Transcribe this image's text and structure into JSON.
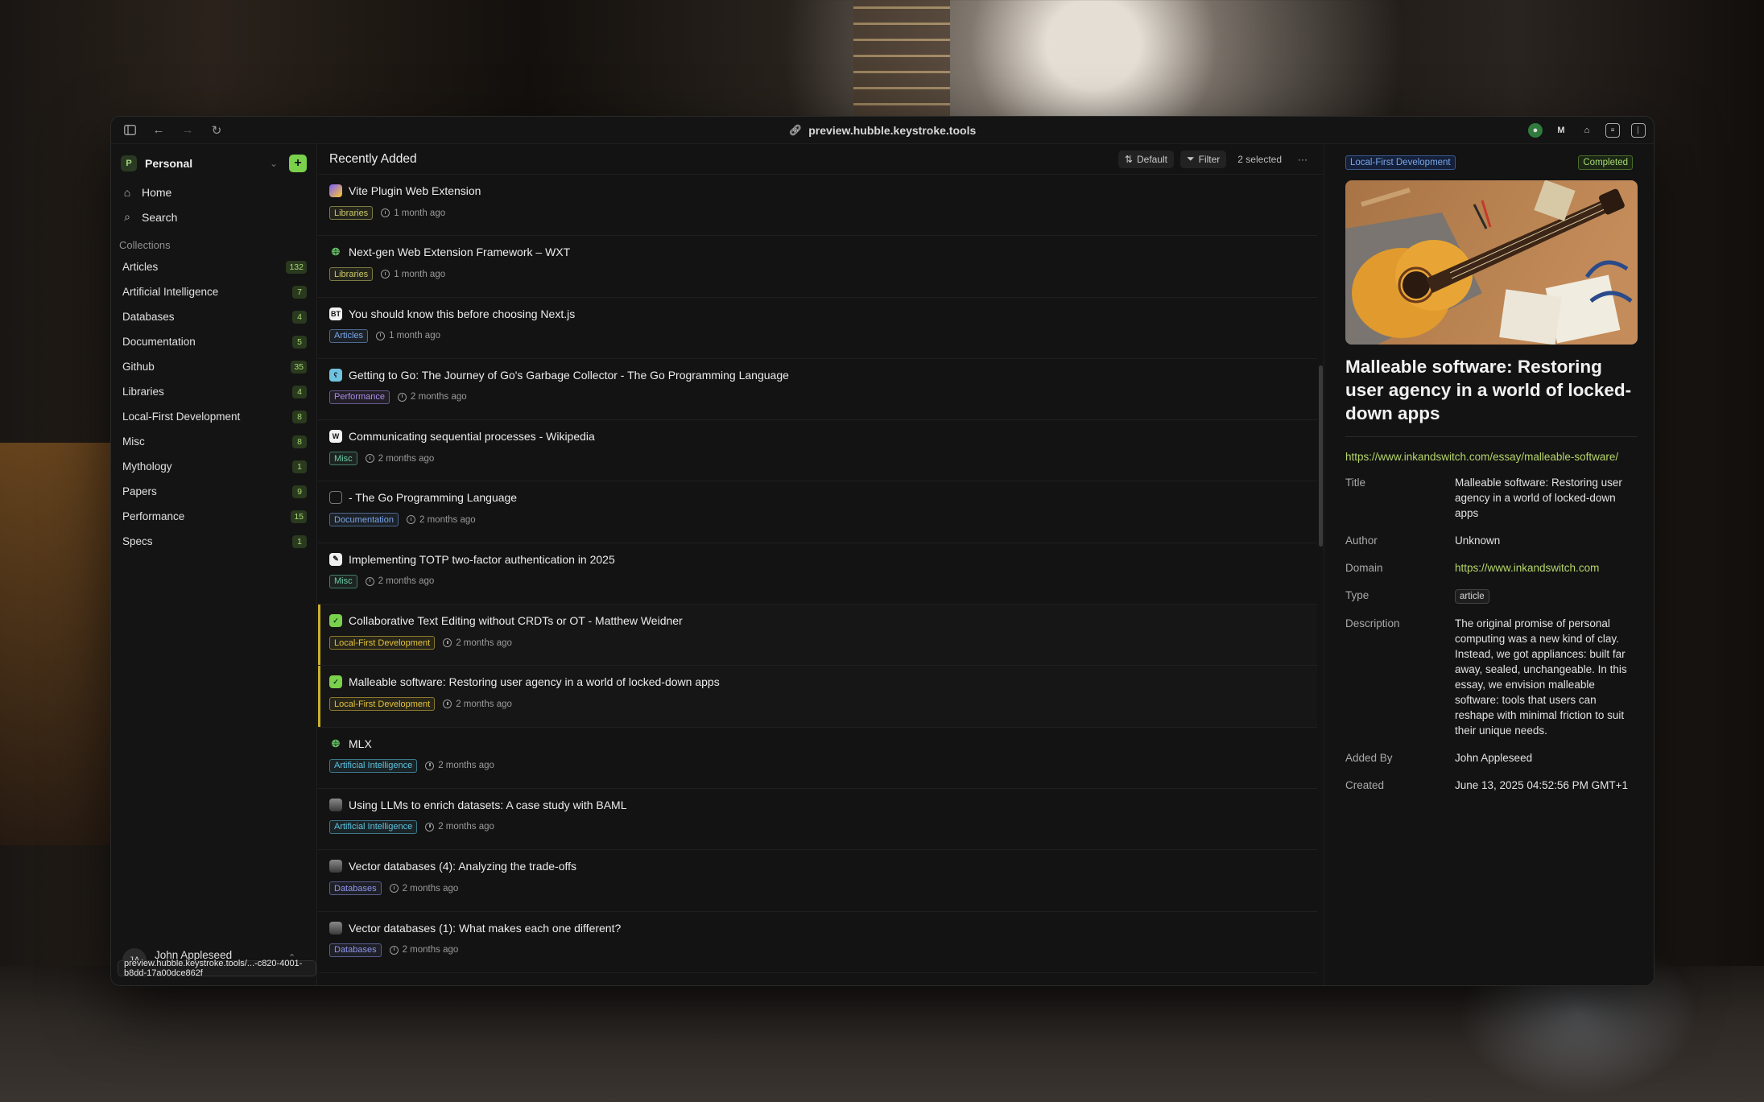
{
  "browser": {
    "url": "preview.hubble.keystroke.tools",
    "status_url": "preview.hubble.keystroke.tools/...-c820-4001-b8dd-17a00dce862f"
  },
  "workspace": {
    "avatar": "P",
    "name": "Personal",
    "add_label": "+"
  },
  "nav": [
    {
      "label": "Home",
      "icon": "home-icon"
    },
    {
      "label": "Search",
      "icon": "search-icon"
    }
  ],
  "collections_heading": "Collections",
  "collections": [
    {
      "label": "Articles",
      "count": "132"
    },
    {
      "label": "Artificial Intelligence",
      "count": "7"
    },
    {
      "label": "Databases",
      "count": "4"
    },
    {
      "label": "Documentation",
      "count": "5"
    },
    {
      "label": "Github",
      "count": "35"
    },
    {
      "label": "Libraries",
      "count": "4"
    },
    {
      "label": "Local-First Development",
      "count": "8"
    },
    {
      "label": "Misc",
      "count": "8"
    },
    {
      "label": "Mythology",
      "count": "1"
    },
    {
      "label": "Papers",
      "count": "9"
    },
    {
      "label": "Performance",
      "count": "15"
    },
    {
      "label": "Specs",
      "count": "1"
    }
  ],
  "user": {
    "initials": "JA",
    "name": "John Appleseed"
  },
  "main": {
    "title": "Recently Added",
    "sort_label": "Default",
    "filter_label": "Filter",
    "selected_label": "2 selected",
    "more_label": "···"
  },
  "items": [
    {
      "title": "Vite Plugin Web Extension",
      "tag": "Libraries",
      "time": "1 month ago",
      "favicon": "vite-icon"
    },
    {
      "title": "Next-gen Web Extension Framework – WXT",
      "tag": "Libraries",
      "time": "1 month ago",
      "favicon": "globe-icon"
    },
    {
      "title": "You should know this before choosing Next.js",
      "tag": "Articles",
      "time": "1 month ago",
      "favicon": "bt-icon"
    },
    {
      "title": "Getting to Go: The Journey of Go's Garbage Collector - The Go Programming Language",
      "tag": "Performance",
      "time": "2 months ago",
      "favicon": "gopher-icon"
    },
    {
      "title": "Communicating sequential processes - Wikipedia",
      "tag": "Misc",
      "time": "2 months ago",
      "favicon": "wikipedia-icon"
    },
    {
      "title": "- The Go Programming Language",
      "tag": "Documentation",
      "time": "2 months ago",
      "favicon": "blank-page-icon"
    },
    {
      "title": "Implementing TOTP two-factor authentication in 2025",
      "tag": "Misc",
      "time": "2 months ago",
      "favicon": "site-icon"
    },
    {
      "title": "Collaborative Text Editing without CRDTs or OT - Matthew Weidner",
      "tag": "Local-First Development",
      "time": "2 months ago",
      "favicon": "checkbox-checked-icon"
    },
    {
      "title": "Malleable software: Restoring user agency in a world of locked-down apps",
      "tag": "Local-First Development",
      "time": "2 months ago",
      "favicon": "checkbox-checked-icon"
    },
    {
      "title": "MLX",
      "tag": "Artificial Intelligence",
      "time": "2 months ago",
      "favicon": "globe-icon"
    },
    {
      "title": "Using LLMs to enrich datasets: A case study with BAML",
      "tag": "Artificial Intelligence",
      "time": "2 months ago",
      "favicon": "photo-icon"
    },
    {
      "title": "Vector databases (4): Analyzing the trade-offs",
      "tag": "Databases",
      "time": "2 months ago",
      "favicon": "photo-icon"
    },
    {
      "title": "Vector databases (1): What makes each one different?",
      "tag": "Databases",
      "time": "2 months ago",
      "favicon": "photo-icon"
    }
  ],
  "tag_colors": {
    "Libraries": "#c9c66a",
    "Articles": "#7aa7e8",
    "Performance": "#a88ee6",
    "Misc": "#6cc9a6",
    "Documentation": "#7aa7e8",
    "Local-First Development": "#e0c23e",
    "Artificial Intelligence": "#5ec3e0",
    "Databases": "#8f96ea"
  },
  "detail": {
    "collection_tag": "Local-First Development",
    "status": "Completed",
    "title": "Malleable software: Restoring user agency in a world of locked-down apps",
    "url": "https://www.inkandswitch.com/essay/malleable-software/",
    "props": [
      {
        "key": "Title",
        "value": "Malleable software: Restoring user agency in a world of locked-down apps"
      },
      {
        "key": "Author",
        "value": "Unknown"
      },
      {
        "key": "Domain",
        "value": "https://www.inkandswitch.com"
      },
      {
        "key": "Type",
        "value": "article"
      },
      {
        "key": "Description",
        "value": "The original promise of personal computing was a new kind of clay. Instead, we got appliances: built far away, sealed, unchangeable. In this essay, we envision malleable software: tools that users can reshape with minimal friction to suit their unique needs."
      },
      {
        "key": "Added By",
        "value": "John Appleseed"
      },
      {
        "key": "Created",
        "value": "June 13, 2025 04:52:56 PM GMT+1"
      }
    ]
  }
}
